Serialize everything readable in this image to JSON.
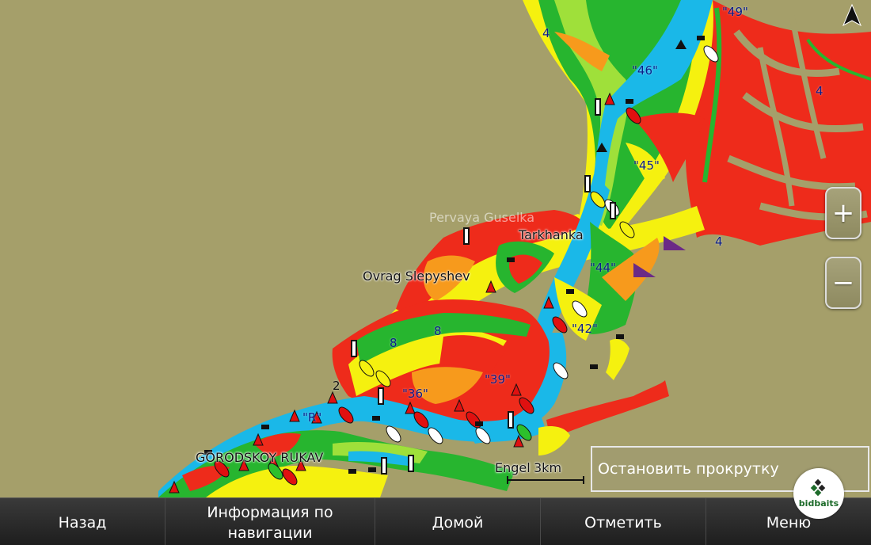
{
  "map": {
    "compass_label": "N",
    "places": {
      "pervaya_guselka": "Pervaya Guselka",
      "tarkhanka": "Tarkhanka",
      "ovrag_slepyshev": "Ovrag Slepyshev",
      "gorodskoy_rukav": "GORODSKOY RUKAV",
      "engel": "Engel"
    },
    "channel_markers": [
      "\"49\"",
      "\"46\"",
      "\"45\"",
      "\"44\"",
      "\"42\"",
      "\"39\"",
      "\"36\"",
      "\"R\""
    ],
    "depth_labels": [
      "4",
      "4",
      "4",
      "8",
      "8",
      "2"
    ],
    "scale_label": "3km",
    "colors": {
      "land": "#a59f6a",
      "deep_water": "#1ab8e8",
      "shallow_green": "#27b52f",
      "light_green": "#9fe03a",
      "yellow": "#f5f10f",
      "orange": "#f79a1c",
      "red": "#ee2b1b"
    }
  },
  "zoom": {
    "in_icon": "+",
    "out_icon": "−"
  },
  "stop_scroll_label": "Остановить прокрутку",
  "bottom_nav": {
    "back": "Назад",
    "nav_info": "Информация по навигации",
    "home": "Домой",
    "mark": "Отметить",
    "menu": "Меню"
  },
  "watermark": {
    "text": "bidbaits"
  }
}
